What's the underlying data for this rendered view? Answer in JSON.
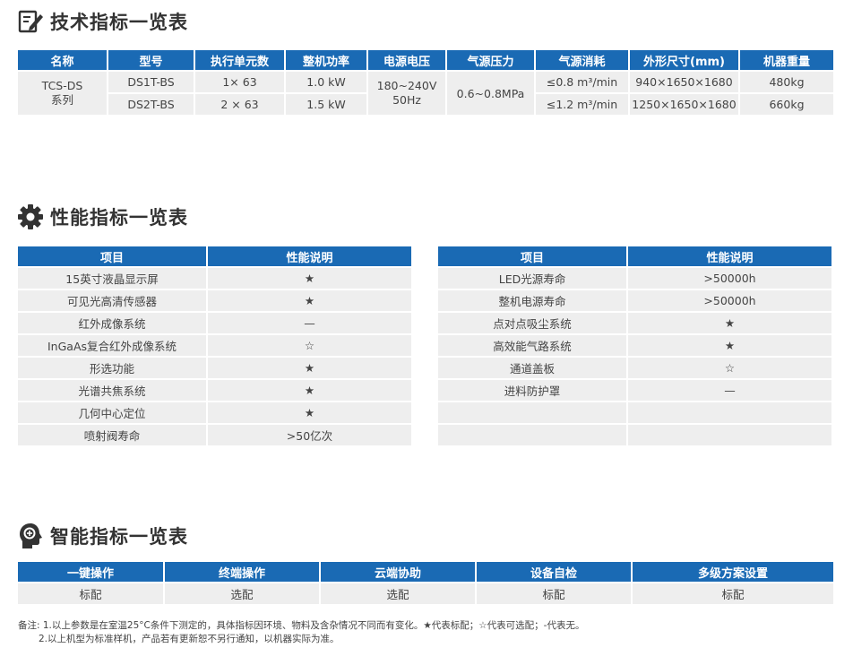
{
  "tech": {
    "title": "技术指标一览表",
    "headers": [
      "名称",
      "型号",
      "执行单元数",
      "整机功率",
      "电源电压",
      "气源压力",
      "气源消耗",
      "外形尺寸(mm)",
      "机器重量"
    ],
    "name_line1": "TCS-DS",
    "name_line2": "系列",
    "rows": [
      {
        "model": "DS1T-BS",
        "units": "1× 63",
        "power": "1.0 kW",
        "consumption": "≤0.8 m³/min",
        "size": "940×1650×1680",
        "weight": "480kg"
      },
      {
        "model": "DS2T-BS",
        "units": "2 × 63",
        "power": "1.5 kW",
        "consumption": "≤1.2 m³/min",
        "size": "1250×1650×1680",
        "weight": "660kg"
      }
    ],
    "voltage_line1": "180~240V",
    "voltage_line2": "50Hz",
    "pressure": "0.6~0.8MPa"
  },
  "perf": {
    "title": "性能指标一览表",
    "headers": [
      "项目",
      "性能说明"
    ],
    "left_rows": [
      [
        "15英寸液晶显示屏",
        "★"
      ],
      [
        "可见光高清传感器",
        "★"
      ],
      [
        "红外成像系统",
        "—"
      ],
      [
        "InGaAs复合红外成像系统",
        "☆"
      ],
      [
        "形选功能",
        "★"
      ],
      [
        "光谱共焦系统",
        "★"
      ],
      [
        "几何中心定位",
        "★"
      ],
      [
        "喷射阀寿命",
        ">50亿次"
      ]
    ],
    "right_rows": [
      [
        "LED光源寿命",
        ">50000h"
      ],
      [
        "整机电源寿命",
        ">50000h"
      ],
      [
        "点对点吸尘系统",
        "★"
      ],
      [
        "高效能气路系统",
        "★"
      ],
      [
        "通道盖板",
        "☆"
      ],
      [
        "进料防护罩",
        "—"
      ],
      [
        "",
        ""
      ],
      [
        "",
        ""
      ]
    ]
  },
  "smart": {
    "title": "智能指标一览表",
    "headers": [
      "一键操作",
      "终端操作",
      "云端协助",
      "设备自检",
      "多级方案设置"
    ],
    "values": [
      "标配",
      "选配",
      "选配",
      "标配",
      "标配"
    ]
  },
  "notes": {
    "line1": "备注: 1.以上参数是在室温25°C条件下测定的，具体指标因环境、物料及含杂情况不同而有变化。★代表标配；☆代表可选配；-代表无。",
    "line2": "2.以上机型为标准样机，产品若有更新恕不另行通知，以机器实际为准。"
  },
  "icons": [
    "edit-icon",
    "gear-icon",
    "head-brain-icon"
  ],
  "colors": {
    "header_bg": "#1a6ab4",
    "cell_bg": "#eeeeee",
    "title": "#333333"
  }
}
